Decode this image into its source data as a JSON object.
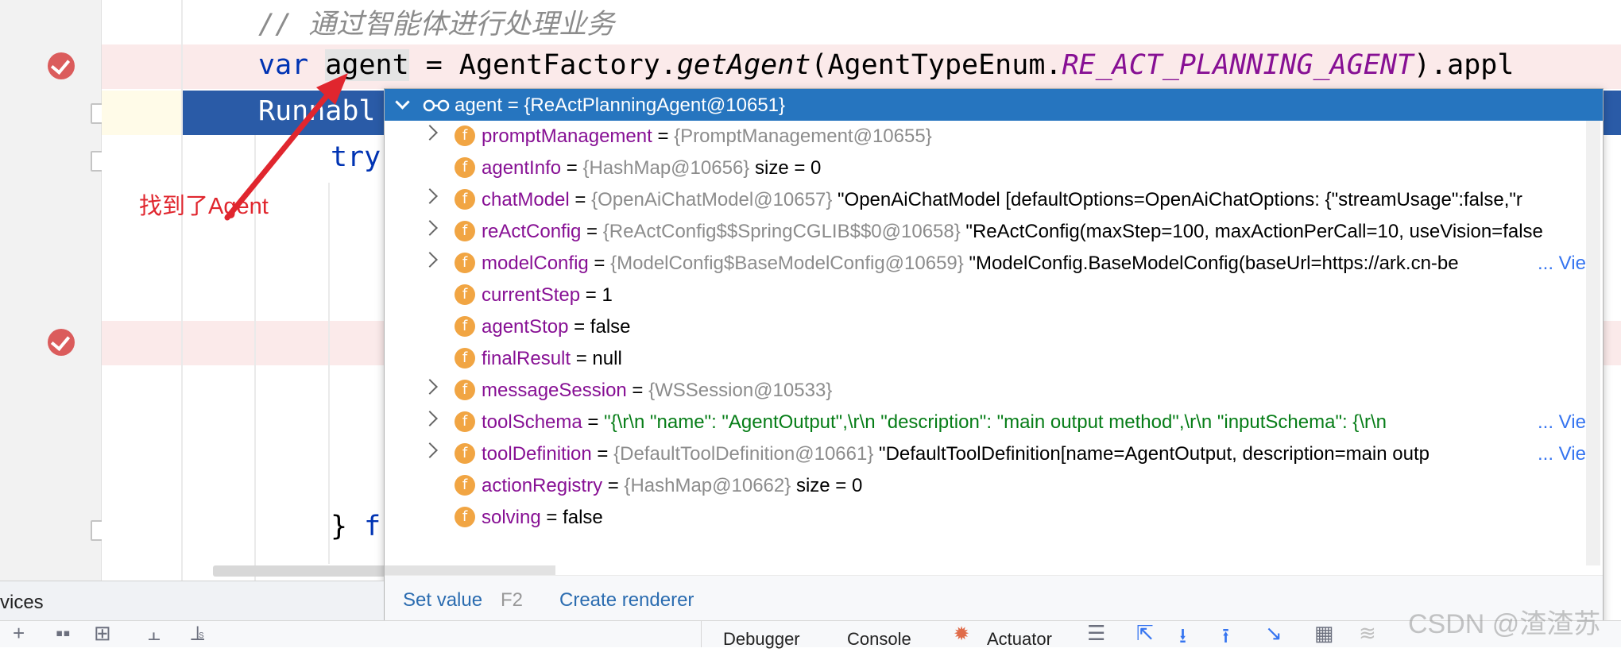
{
  "editor": {
    "lines": [
      {
        "comment": "// 通过智能体进行处理业务"
      },
      {
        "kw": "var",
        "var_name": "agent",
        "rest": " = AgentFactory.",
        "method": "getAgent",
        "paren_open": "(AgentTypeEnum.",
        "const": "RE_ACT_PLANNING_AGENT",
        "tail": ").appl"
      },
      {
        "text": "Runnabl"
      },
      {
        "kw": "try"
      },
      {
        "brace": "}",
        "kw": "f"
      }
    ]
  },
  "annotation": {
    "text": "找到了Agent",
    "color": "#e0262e"
  },
  "popup": {
    "header": "agent = {ReActPlanningAgent@10651}",
    "rows": [
      {
        "name": "promptManagement",
        "eq": " = ",
        "type": "{PromptManagement@10655}",
        "value": "",
        "view": "",
        "expand": true
      },
      {
        "name": "agentInfo",
        "eq": " = ",
        "type": "{HashMap@10656}",
        "value": "  size = 0",
        "view": "",
        "expand": false
      },
      {
        "name": "chatModel",
        "eq": " = ",
        "type": "{OpenAiChatModel@10657}",
        "value": " \"OpenAiChatModel [defaultOptions=OpenAiChatOptions: {\"streamUsage\":false,\"r",
        "view": "",
        "expand": true
      },
      {
        "name": "reActConfig",
        "eq": " = ",
        "type": "{ReActConfig$$SpringCGLIB$$0@10658}",
        "value": " \"ReActConfig(maxStep=100, maxActionPerCall=10, useVision=false",
        "view": "",
        "expand": true
      },
      {
        "name": "modelConfig",
        "eq": " = ",
        "type": "{ModelConfig$BaseModelConfig@10659}",
        "value": " \"ModelConfig.BaseModelConfig(baseUrl=https://ark.cn-be",
        "view": "... View",
        "expand": true
      },
      {
        "name": "currentStep",
        "eq": " = ",
        "type": "",
        "value": "1",
        "view": "",
        "expand": false
      },
      {
        "name": "agentStop",
        "eq": " = ",
        "type": "",
        "value": "false",
        "view": "",
        "expand": false
      },
      {
        "name": "finalResult",
        "eq": " = ",
        "type": "",
        "value": "null",
        "view": "",
        "expand": false
      },
      {
        "name": "messageSession",
        "eq": " = ",
        "type": "{WSSession@10533}",
        "value": "",
        "view": "",
        "expand": true
      },
      {
        "name": "toolSchema",
        "eq": " = ",
        "type": "",
        "value": "",
        "str": "\"{\\r\\n  \"name\": \"AgentOutput\",\\r\\n  \"description\": \"main output method\",\\r\\n  \"inputSchema\": {\\r\\n",
        "view": "... View",
        "expand": true
      },
      {
        "name": "toolDefinition",
        "eq": " = ",
        "type": "{DefaultToolDefinition@10661}",
        "value": " \"DefaultToolDefinition[name=AgentOutput, description=main outp",
        "view": "... View",
        "expand": true
      },
      {
        "name": "actionRegistry",
        "eq": " = ",
        "type": "{HashMap@10662}",
        "value": "  size = 0",
        "view": "",
        "expand": false
      },
      {
        "name": "solving",
        "eq": " = ",
        "type": "",
        "value": "false",
        "view": "",
        "expand": false
      }
    ],
    "footer": {
      "set_value": "Set value",
      "set_value_key": "F2",
      "create_renderer": "Create renderer"
    }
  },
  "bottom": {
    "services_label": "vices",
    "tabs": [
      "Debugger",
      "Console",
      "Actuator"
    ],
    "watermark": "CSDN @渣渣苏"
  },
  "colors": {
    "selection": "#2a5ba7",
    "breakpoint_line": "#fbeaea",
    "popup_header": "#2675bf"
  }
}
